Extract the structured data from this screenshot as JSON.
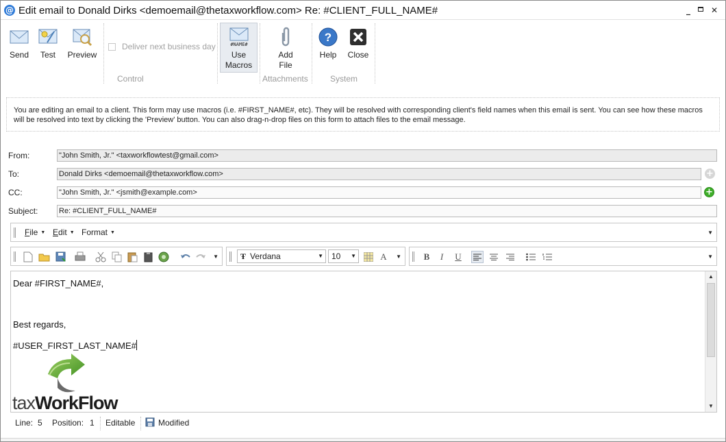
{
  "window": {
    "title": "Edit email to Donald Dirks <demoemail@thetaxworkflow.com> Re: #CLIENT_FULL_NAME#",
    "app_icon_glyph": "@",
    "minimize": "_",
    "maximize": "□",
    "close": "✕"
  },
  "ribbon": {
    "send": "Send",
    "test": "Test",
    "preview": "Preview",
    "deliver_checkbox": "Deliver next business day",
    "use_macros_line1": "Use",
    "use_macros_line2": "Macros",
    "macro_icon_text": "#NAME#",
    "add_file_line1": "Add",
    "add_file_line2": "File",
    "help": "Help",
    "close": "Close",
    "group_control": "Control",
    "group_attachments": "Attachments",
    "group_system": "System"
  },
  "info_text": "You are editing an email to a client. This form may use macros (i.e. #FIRST_NAME#, etc). They will be resolved with corresponding client's field names when this email is sent. You can see how these macros will be resolved into text by clicking the 'Preview' button. You can also drag-n-drop files on this form to attach files to the email message.",
  "fields": {
    "from_label": "From:",
    "from_value": "\"John Smith, Jr.\" <taxworkflowtest@gmail.com>",
    "to_label": "To:",
    "to_value": "Donald Dirks <demoemail@thetaxworkflow.com>",
    "cc_label": "CC:",
    "cc_value": "\"John Smith, Jr.\" <jsmith@example.com>",
    "subject_label": "Subject:",
    "subject_value": "Re: #CLIENT_FULL_NAME#"
  },
  "menubar": {
    "file_u": "F",
    "file_rest": "ile",
    "edit_u": "E",
    "edit_rest": "dit",
    "format": "Format"
  },
  "toolbar": {
    "font_name": "Verdana",
    "font_size": "10",
    "bold": "B",
    "italic": "I",
    "underline": "U",
    "font_color": "A"
  },
  "editor": {
    "line1": "Dear #FIRST_NAME#,",
    "line2": "",
    "line3": "Best regards,",
    "line4": "#USER_FIRST_LAST_NAME#",
    "logo_tax": "tax",
    "logo_workflow": "WorkFlow"
  },
  "status": {
    "line_label": "Line:",
    "line_value": "5",
    "position_label": "Position:",
    "position_value": "1",
    "editable": "Editable",
    "modified": "Modified"
  },
  "colors": {
    "accent_blue": "#2f7bd8",
    "add_green": "#3fae2a",
    "logo_green": "#5aa52d"
  }
}
